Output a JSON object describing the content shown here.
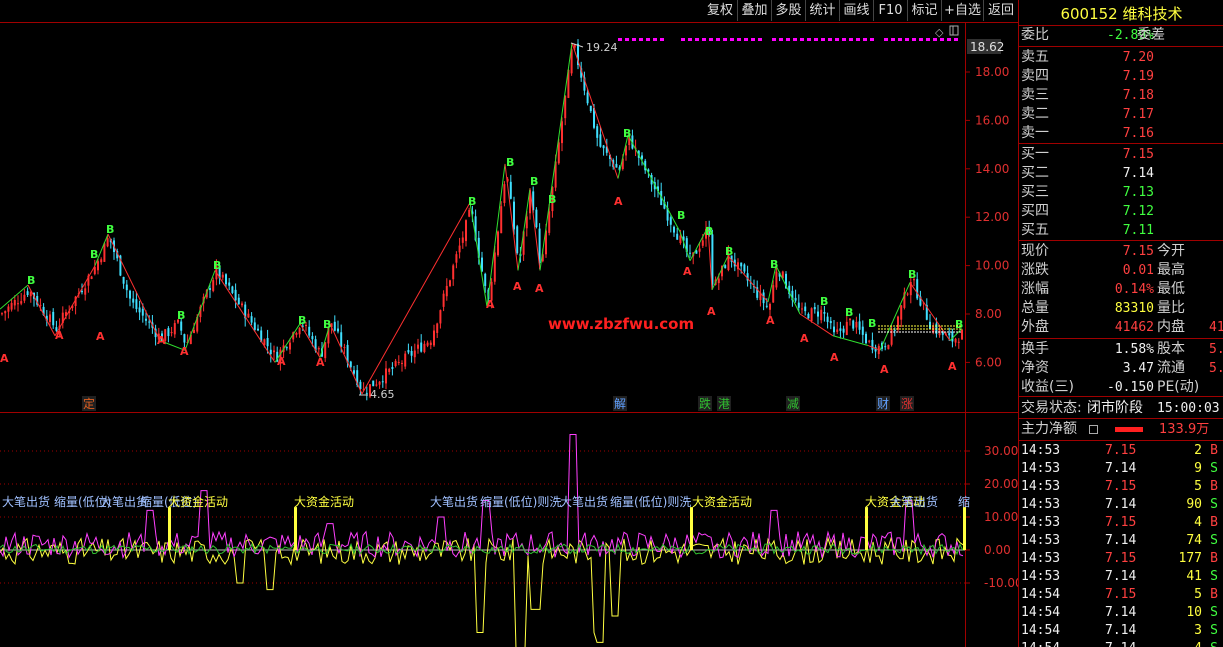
{
  "toolbar": {
    "buttons": [
      "复权",
      "叠加",
      "多股",
      "统计",
      "画线",
      "F10",
      "标记",
      "+自选",
      "返回"
    ]
  },
  "stock": {
    "code": "600152",
    "name": "维科技术"
  },
  "chart": {
    "price_axis": [
      "18.00",
      "16.00",
      "14.00",
      "12.00",
      "10.00",
      "8.00",
      "6.00"
    ],
    "current_price_tag": "18.62",
    "peak_label": "19.24",
    "trough_label": "4.65",
    "watermark": "www.zbzfwu.com",
    "events": [
      {
        "text": "定",
        "color": "#e06020"
      },
      {
        "text": "解",
        "color": "#60a0ff"
      },
      {
        "text": "跌",
        "color": "#30c030"
      },
      {
        "text": "港",
        "color": "#30c030"
      },
      {
        "text": "减",
        "color": "#30c030"
      },
      {
        "text": "财",
        "color": "#60a0ff"
      },
      {
        "text": "涨",
        "color": "#e03030"
      }
    ],
    "wave_b": "B",
    "wave_a": "A",
    "indicator_axis": [
      "30.00",
      "20.00",
      "10.00",
      "0.00",
      "-10.00"
    ],
    "annotations": [
      {
        "text": "大笔出货",
        "color": "#a0c0ff"
      },
      {
        "text": "缩量(低位)",
        "color": "#a0c0ff"
      },
      {
        "text": "大笔出货",
        "color": "#a0c0ff"
      },
      {
        "text": "缩量(低位)",
        "color": "#a0c0ff"
      },
      {
        "text": "大资金活动",
        "color": "#ffff40"
      },
      {
        "text": "大资金活动",
        "color": "#ffff40"
      },
      {
        "text": "大笔出货",
        "color": "#a0c0ff"
      },
      {
        "text": "缩量(低位)则洗",
        "color": "#a0c0ff"
      },
      {
        "text": "大笔出货",
        "color": "#a0c0ff"
      },
      {
        "text": "缩量(低位)则洗",
        "color": "#a0c0ff"
      },
      {
        "text": "大资金活动",
        "color": "#ffff40"
      },
      {
        "text": "大资金活动",
        "color": "#ffff40"
      },
      {
        "text": "大笔出货",
        "color": "#a0c0ff"
      },
      {
        "text": "缩",
        "color": "#a0c0ff"
      }
    ]
  },
  "quote": {
    "weibi_label": "委比",
    "weibi_value": "-2.89%",
    "weicha_label": "委差",
    "asks": [
      {
        "label": "卖五",
        "price": "7.20"
      },
      {
        "label": "卖四",
        "price": "7.19"
      },
      {
        "label": "卖三",
        "price": "7.18"
      },
      {
        "label": "卖二",
        "price": "7.17"
      },
      {
        "label": "卖一",
        "price": "7.16"
      }
    ],
    "bids": [
      {
        "label": "买一",
        "price": "7.15",
        "color": "#ff4040"
      },
      {
        "label": "买二",
        "price": "7.14",
        "color": "#f0f0f0"
      },
      {
        "label": "买三",
        "price": "7.13",
        "color": "#40ff40"
      },
      {
        "label": "买四",
        "price": "7.12",
        "color": "#40ff40"
      },
      {
        "label": "买五",
        "price": "7.11",
        "color": "#40ff40"
      }
    ],
    "stats": [
      {
        "label": "现价",
        "value": "7.15",
        "color": "#ff4040",
        "label2": "今开",
        "value2": ""
      },
      {
        "label": "涨跌",
        "value": "0.01",
        "color": "#ff4040",
        "label2": "最高",
        "value2": ""
      },
      {
        "label": "涨幅",
        "value": "0.14%",
        "color": "#ff4040",
        "label2": "最低",
        "value2": ""
      },
      {
        "label": "总量",
        "value": "83310",
        "color": "#ffff40",
        "label2": "量比",
        "value2": ""
      },
      {
        "label": "外盘",
        "value": "41462",
        "color": "#ff4040",
        "label2": "内盘",
        "value2": "41"
      }
    ],
    "stats2": [
      {
        "label": "换手",
        "value": "1.58%",
        "color": "#f0f0f0",
        "label2": "股本",
        "value2": "5.2"
      },
      {
        "label": "净资",
        "value": "3.47",
        "color": "#f0f0f0",
        "label2": "流通",
        "value2": "5.2"
      },
      {
        "label": "收益(三)",
        "value": "-0.150",
        "color": "#f0f0f0",
        "label2": "PE(动)",
        "value2": ""
      }
    ],
    "trade_status_label": "交易状态:",
    "trade_status": "闭市阶段",
    "trade_time": "15:00:03",
    "main_flow_label": "主力净额",
    "main_flow_value": "133.9万"
  },
  "ticks": [
    {
      "time": "14:53",
      "price": "7.15",
      "pcolor": "#ff4040",
      "vol": "2",
      "side": "B"
    },
    {
      "time": "14:53",
      "price": "7.14",
      "pcolor": "#f0f0f0",
      "vol": "9",
      "side": "S"
    },
    {
      "time": "14:53",
      "price": "7.15",
      "pcolor": "#ff4040",
      "vol": "5",
      "side": "B"
    },
    {
      "time": "14:53",
      "price": "7.14",
      "pcolor": "#f0f0f0",
      "vol": "90",
      "side": "S"
    },
    {
      "time": "14:53",
      "price": "7.15",
      "pcolor": "#ff4040",
      "vol": "4",
      "side": "B"
    },
    {
      "time": "14:53",
      "price": "7.14",
      "pcolor": "#f0f0f0",
      "vol": "74",
      "side": "S"
    },
    {
      "time": "14:53",
      "price": "7.15",
      "pcolor": "#ff4040",
      "vol": "177",
      "side": "B"
    },
    {
      "time": "14:53",
      "price": "7.14",
      "pcolor": "#f0f0f0",
      "vol": "41",
      "side": "S"
    },
    {
      "time": "14:54",
      "price": "7.15",
      "pcolor": "#ff4040",
      "vol": "5",
      "side": "B"
    },
    {
      "time": "14:54",
      "price": "7.14",
      "pcolor": "#f0f0f0",
      "vol": "10",
      "side": "S"
    },
    {
      "time": "14:54",
      "price": "7.14",
      "pcolor": "#f0f0f0",
      "vol": "3",
      "side": "S"
    },
    {
      "time": "14:54",
      "price": "7.14",
      "pcolor": "#f0f0f0",
      "vol": "4",
      "side": "S"
    }
  ]
}
